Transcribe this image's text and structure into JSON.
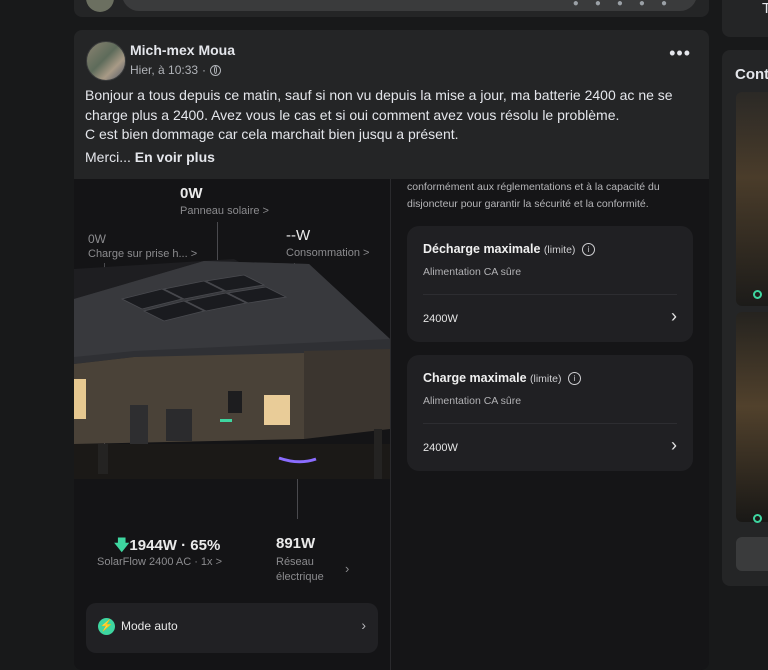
{
  "post": {
    "author": "Mich-mex Moua",
    "timestamp": "Hier, à 10:33",
    "privacy_sep": "·",
    "text_lines": [
      "Bonjour a tous depuis ce matin, sauf si non vu depuis la mise a jour, ma batterie 2400 ac ne se charge plus a 2400. Avez vous le cas et si oui comment avez vous résolu le problème.",
      "C est bien dommage car cela marchait bien jusqu a présent."
    ],
    "truncated_text": "Merci...",
    "see_more": "En voir plus"
  },
  "side_panel": {
    "title": "Cont",
    "top_letter": "T"
  },
  "screenshot": {
    "solar": {
      "value": "0W",
      "label": "Panneau solaire >"
    },
    "plug_charge": {
      "value": "0W",
      "label": "Charge sur prise h... >"
    },
    "consumption": {
      "value": "--W",
      "label": "Consommation >"
    },
    "battery": {
      "value": "1944W · 65%",
      "label": "SolarFlow 2400 AC · 1x >"
    },
    "grid": {
      "value": "891W",
      "label_line1": "Réseau",
      "label_line2": "électrique"
    },
    "mode": "Mode auto",
    "notice": "conformément aux réglementations et à la capacité du disjoncteur pour garantir la sécurité et la conformité.",
    "settings": [
      {
        "title": "Décharge maximale",
        "qualifier": "(limite)",
        "subtitle": "Alimentation CA sûre",
        "value": "2400W"
      },
      {
        "title": "Charge maximale",
        "qualifier": "(limite)",
        "subtitle": "Alimentation CA sûre",
        "value": "2400W"
      }
    ]
  },
  "colors": {
    "accent_green": "#3ed6a0",
    "card_bg": "#242526",
    "page_bg": "#18191a"
  }
}
